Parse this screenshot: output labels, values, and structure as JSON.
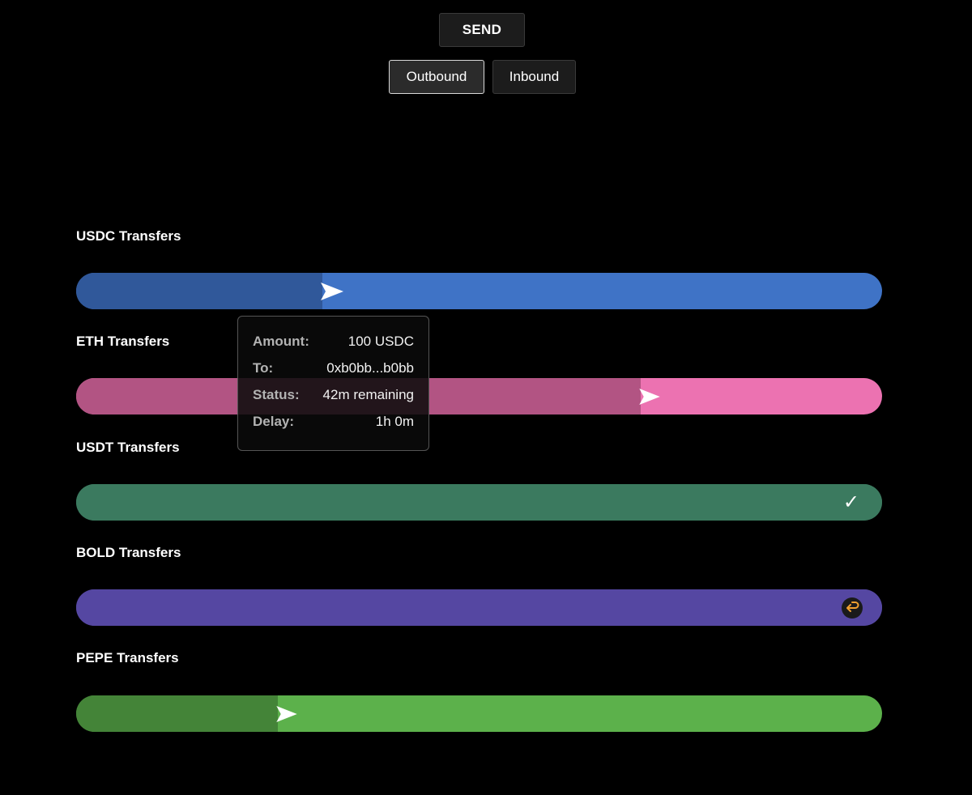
{
  "header": {
    "send_label": "SEND",
    "tabs": [
      {
        "label": "Outbound",
        "active": true
      },
      {
        "label": "Inbound",
        "active": false
      }
    ]
  },
  "transfers": [
    {
      "title": "USDC Transfers",
      "track_color": "#3f73c6",
      "fill_color": "#30589a",
      "progress": 0.306,
      "status_icon": "send-arrow-icon"
    },
    {
      "title": "ETH Transfers",
      "track_color": "#ec72b1",
      "fill_color": "#b25483",
      "progress": 0.7,
      "status_icon": "send-arrow-icon"
    },
    {
      "title": "USDT Transfers",
      "track_color": "#3b7a5f",
      "fill_color": "#3b7a5f",
      "progress": 1.0,
      "status_icon": "checkmark-icon",
      "status_glyph": "✓"
    },
    {
      "title": "BOLD Transfers",
      "track_color": "#5547a2",
      "fill_color": "#5547a2",
      "progress": 1.0,
      "status_icon": "return-arrow-icon"
    },
    {
      "title": "PEPE Transfers",
      "track_color": "#5cb14b",
      "fill_color": "#448438",
      "progress": 0.25,
      "status_icon": "send-arrow-icon"
    }
  ],
  "tooltip": {
    "rows": [
      {
        "label": "Amount:",
        "value": "100 USDC"
      },
      {
        "label": "To:",
        "value": "0xb0bb...b0bb"
      },
      {
        "label": "Status:",
        "value": "42m remaining"
      },
      {
        "label": "Delay:",
        "value": "1h 0m"
      }
    ]
  },
  "colors": {
    "background": "#000000",
    "return_icon": "#f0a030"
  }
}
